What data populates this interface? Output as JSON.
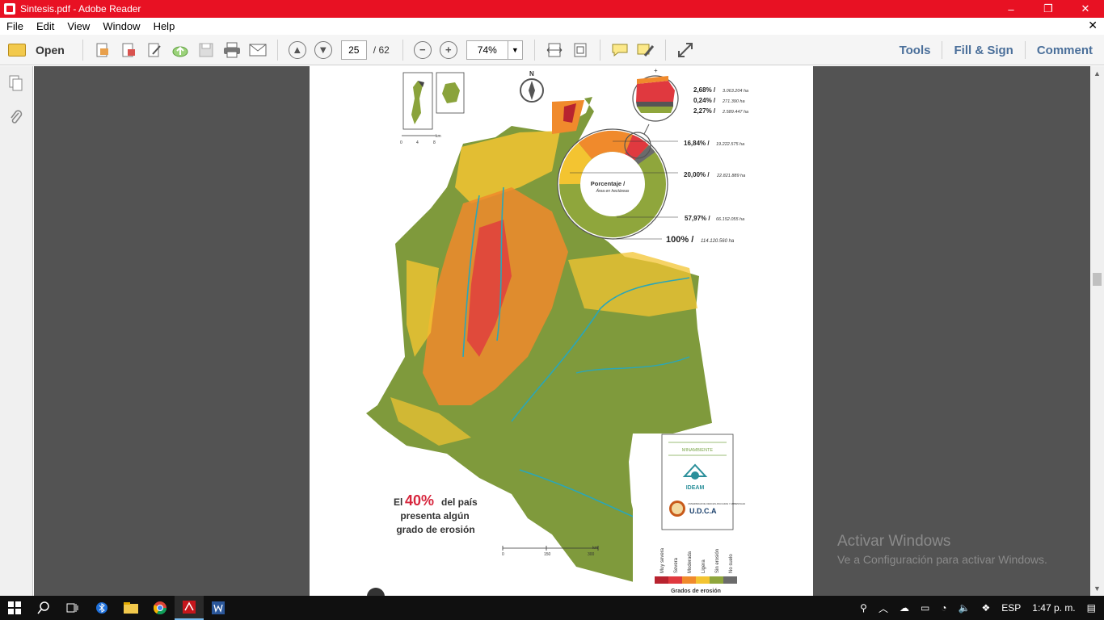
{
  "window": {
    "title": "Sintesis.pdf - Adobe Reader",
    "minimize": "–",
    "restore": "❐",
    "close": "✕"
  },
  "menu": {
    "items": [
      "File",
      "Edit",
      "View",
      "Window",
      "Help"
    ],
    "close": "✕"
  },
  "toolbar": {
    "open_label": "Open",
    "current_page": "25",
    "total_pages": "/ 62",
    "zoom": "74%",
    "right_links": [
      "Tools",
      "Fill & Sign",
      "Comment"
    ]
  },
  "pdf": {
    "compass": "N",
    "inset_scale": [
      "0",
      "4",
      "8",
      "km"
    ],
    "scale": [
      "0",
      "150",
      "300",
      "km"
    ],
    "chart": {
      "center_title": "Porcentaje /",
      "center_sub": "Área en hectáreas",
      "plus": "+",
      "labels": [
        {
          "pct": "2,68% /",
          "ha": "3.063.204 ha"
        },
        {
          "pct": "0,24% /",
          "ha": "271.390 ha"
        },
        {
          "pct": "2,27% /",
          "ha": "2.589.447 ha"
        },
        {
          "pct": "16,84% /",
          "ha": "19.222.575 ha"
        },
        {
          "pct": "20,00% /",
          "ha": "22.821.889 ha"
        },
        {
          "pct": "57,97% /",
          "ha": "66.152.055 ha"
        },
        {
          "pct": "100% /",
          "ha": "114.120.560 ha"
        }
      ]
    },
    "headline": {
      "prefix": "El",
      "big": "40%",
      "rest1": "del país",
      "rest2": "presenta algún",
      "rest3": "grado de erosión"
    },
    "legend": {
      "title": "Grados de erosión",
      "items": [
        "Muy severa",
        "Severa",
        "Moderada",
        "Ligera",
        "Sin erosión",
        "No suelo"
      ],
      "colors": [
        "#b8232f",
        "#e0393f",
        "#f08a2c",
        "#f3c431",
        "#8fa63c",
        "#6b6b6b"
      ]
    },
    "logos": {
      "l1": "MINAMBIENTE",
      "l2": "IDEAM",
      "l3": "U.D.C.A",
      "l3_small": "UNIVERSIDAD DE CIENCIAS APLICADAS Y AMBIENTALES"
    }
  },
  "watermark": {
    "line1": "Activar Windows",
    "line2": "Ve a Configuración para activar Windows."
  },
  "taskbar": {
    "lang": "ESP",
    "time": "1:47 p. m."
  }
}
